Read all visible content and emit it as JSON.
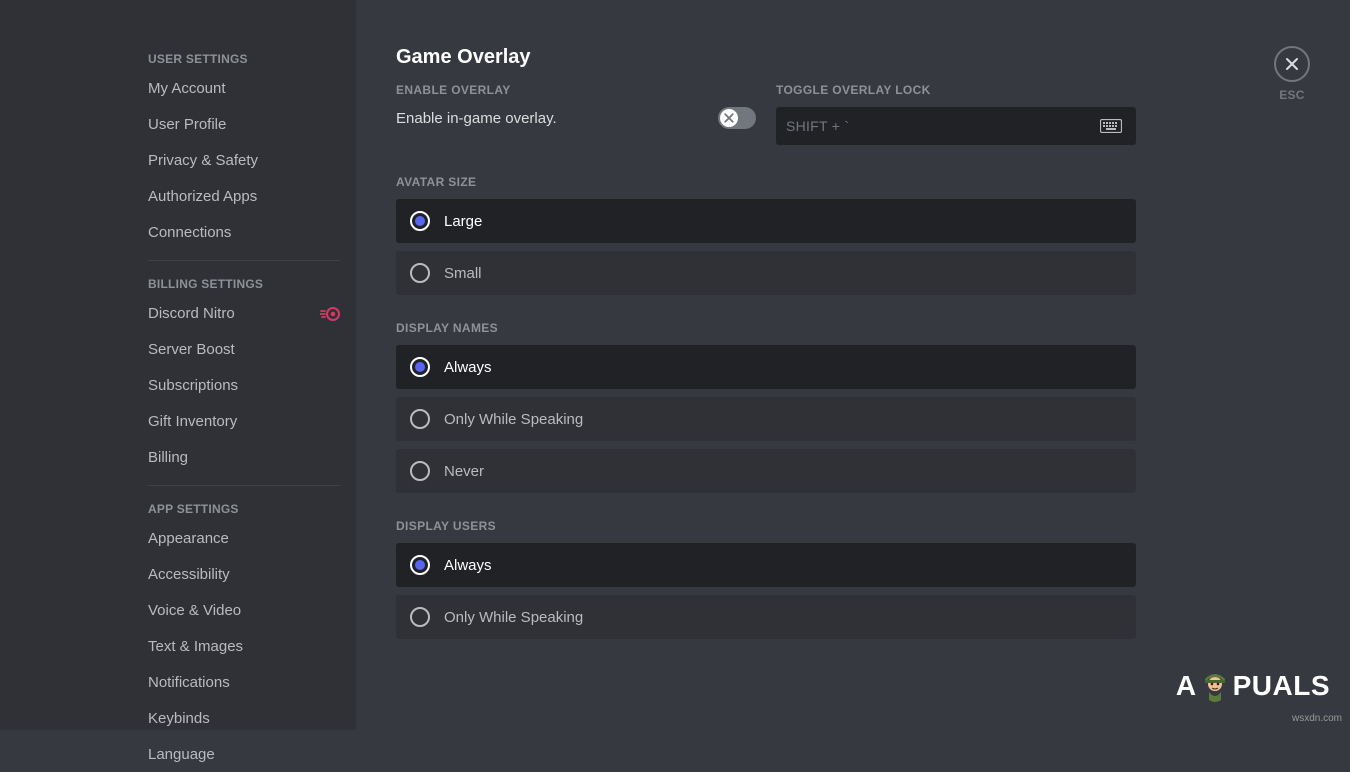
{
  "sidebar": {
    "sections": [
      {
        "title": "USER SETTINGS",
        "items": [
          {
            "label": "My Account",
            "key": "my-account"
          },
          {
            "label": "User Profile",
            "key": "user-profile"
          },
          {
            "label": "Privacy & Safety",
            "key": "privacy-safety"
          },
          {
            "label": "Authorized Apps",
            "key": "authorized-apps"
          },
          {
            "label": "Connections",
            "key": "connections"
          }
        ]
      },
      {
        "title": "BILLING SETTINGS",
        "items": [
          {
            "label": "Discord Nitro",
            "key": "discord-nitro",
            "icon": "nitro"
          },
          {
            "label": "Server Boost",
            "key": "server-boost"
          },
          {
            "label": "Subscriptions",
            "key": "subscriptions"
          },
          {
            "label": "Gift Inventory",
            "key": "gift-inventory"
          },
          {
            "label": "Billing",
            "key": "billing"
          }
        ]
      },
      {
        "title": "APP SETTINGS",
        "items": [
          {
            "label": "Appearance",
            "key": "appearance"
          },
          {
            "label": "Accessibility",
            "key": "accessibility"
          },
          {
            "label": "Voice & Video",
            "key": "voice-video"
          },
          {
            "label": "Text & Images",
            "key": "text-images"
          },
          {
            "label": "Notifications",
            "key": "notifications"
          },
          {
            "label": "Keybinds",
            "key": "keybinds"
          },
          {
            "label": "Language",
            "key": "language"
          }
        ]
      }
    ]
  },
  "main": {
    "title": "Game Overlay",
    "enable": {
      "section_label": "ENABLE OVERLAY",
      "text": "Enable in-game overlay.",
      "value": false
    },
    "toggle_lock": {
      "section_label": "TOGGLE OVERLAY LOCK",
      "keybind": "SHIFT + `"
    },
    "avatar_size": {
      "section_label": "AVATAR SIZE",
      "options": [
        "Large",
        "Small"
      ],
      "selected": "Large"
    },
    "display_names": {
      "section_label": "DISPLAY NAMES",
      "options": [
        "Always",
        "Only While Speaking",
        "Never"
      ],
      "selected": "Always"
    },
    "display_users": {
      "section_label": "DISPLAY USERS",
      "options": [
        "Always",
        "Only While Speaking"
      ],
      "selected": "Always"
    }
  },
  "close": {
    "esc_label": "ESC"
  },
  "watermark": "wsxdn.com",
  "brand": {
    "part1": "A",
    "part2": "PUALS"
  }
}
